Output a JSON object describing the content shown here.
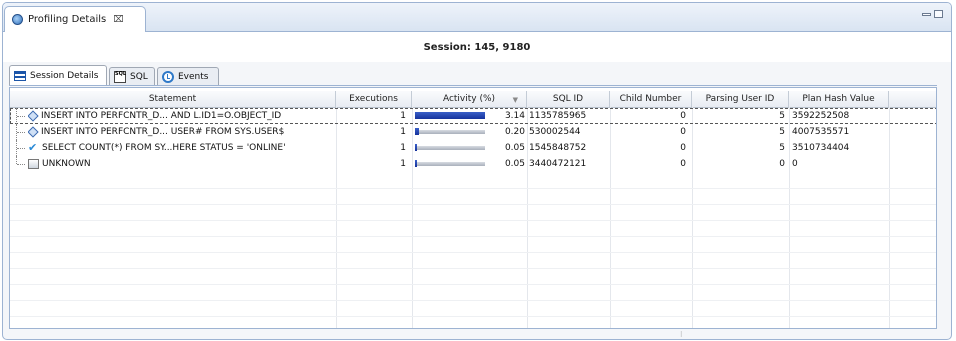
{
  "view": {
    "title": "Profiling Details",
    "close_symbol": "⌧",
    "session_label": "Session: 145, 9180"
  },
  "subtabs": [
    {
      "label": "Session Details",
      "icon": "grid-icon"
    },
    {
      "label": "SQL",
      "icon": "sql-icon"
    },
    {
      "label": "Events",
      "icon": "events-icon"
    }
  ],
  "table": {
    "columns": [
      "Statement",
      "Executions",
      "Activity (%)",
      "SQL ID",
      "Child Number",
      "Parsing User ID",
      "Plan Hash Value"
    ],
    "sort_arrow": "▼",
    "rows": [
      {
        "icon": "execute-icon",
        "statement": "INSERT INTO PERFCNTR_D... AND L.ID1=O.OBJECT_ID",
        "executions": "1",
        "activity": "3.14",
        "activity_fraction": 1.0,
        "sql_id": "1135785965",
        "child_number": "0",
        "parsing_user_id": "5",
        "plan_hash_value": "3592252508"
      },
      {
        "icon": "execute-icon",
        "statement": "INSERT INTO PERFCNTR_D... USER# FROM SYS.USER$",
        "executions": "1",
        "activity": "0.20",
        "activity_fraction": 0.06,
        "sql_id": "530002544",
        "child_number": "0",
        "parsing_user_id": "5",
        "plan_hash_value": "4007535571"
      },
      {
        "icon": "checkmark-icon",
        "statement": "SELECT COUNT(*) FROM SY...HERE STATUS = 'ONLINE'",
        "executions": "1",
        "activity": "0.05",
        "activity_fraction": 0.02,
        "sql_id": "1545848752",
        "child_number": "0",
        "parsing_user_id": "5",
        "plan_hash_value": "3510734404"
      },
      {
        "icon": "unknown-icon",
        "statement": "UNKNOWN",
        "executions": "1",
        "activity": "0.05",
        "activity_fraction": 0.02,
        "sql_id": "3440472121",
        "child_number": "0",
        "parsing_user_id": "0",
        "plan_hash_value": "0"
      }
    ]
  },
  "colors": {
    "accent": "#15329c",
    "border": "#9db3d2"
  }
}
